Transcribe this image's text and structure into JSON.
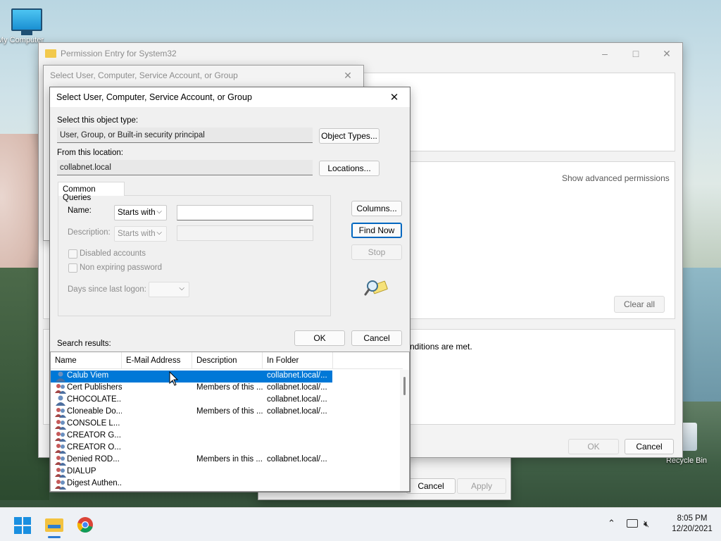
{
  "desktop": {
    "my_computer_label": "My Computer",
    "recycle_bin_label": "Recycle Bin"
  },
  "perm_window": {
    "title": "Permission Entry for System32",
    "show_advanced": "Show advanced permissions",
    "clear_all": "Clear all",
    "conditions_text": "nditions are met.",
    "ok": "OK",
    "cancel": "Cancel"
  },
  "behind_window": {
    "cancel": "Cancel",
    "apply": "Apply"
  },
  "bg_select_dialog": {
    "title": "Select User, Computer, Service Account, or Group"
  },
  "dialog": {
    "title": "Select User, Computer, Service Account, or Group",
    "object_type_label": "Select this object type:",
    "object_type_value": "User, Group, or Built-in security principal",
    "object_types_button": "Object Types...",
    "location_label": "From this location:",
    "location_value": "collabnet.local",
    "locations_button": "Locations...",
    "tab_common_queries": "Common Queries",
    "name_label": "Name:",
    "name_filter": "Starts with",
    "description_label": "Description:",
    "description_filter": "Starts with",
    "disabled_accounts": "Disabled accounts",
    "non_expiring_password": "Non expiring password",
    "days_since_last_logon": "Days since last logon:",
    "columns_button": "Columns...",
    "find_now_button": "Find Now",
    "stop_button": "Stop",
    "ok_button": "OK",
    "cancel_button": "Cancel",
    "search_results_label": "Search results:",
    "columns": [
      "Name",
      "E-Mail Address",
      "Description",
      "In Folder"
    ],
    "results": [
      {
        "name": "Calub Viem",
        "email": "",
        "description": "",
        "folder": "collabnet.local/...",
        "type": "user",
        "selected": true
      },
      {
        "name": "Cert Publishers",
        "email": "",
        "description": "Members of this ...",
        "folder": "collabnet.local/...",
        "type": "group",
        "selected": false
      },
      {
        "name": "CHOCOLATE...",
        "email": "",
        "description": "",
        "folder": "collabnet.local/...",
        "type": "user",
        "selected": false
      },
      {
        "name": "Cloneable Do...",
        "email": "",
        "description": "Members of this ...",
        "folder": "collabnet.local/...",
        "type": "group",
        "selected": false
      },
      {
        "name": "CONSOLE L...",
        "email": "",
        "description": "",
        "folder": "",
        "type": "group",
        "selected": false
      },
      {
        "name": "CREATOR G...",
        "email": "",
        "description": "",
        "folder": "",
        "type": "group",
        "selected": false
      },
      {
        "name": "CREATOR O...",
        "email": "",
        "description": "",
        "folder": "",
        "type": "group",
        "selected": false
      },
      {
        "name": "Denied ROD...",
        "email": "",
        "description": "Members in this ...",
        "folder": "collabnet.local/...",
        "type": "group",
        "selected": false
      },
      {
        "name": "DIALUP",
        "email": "",
        "description": "",
        "folder": "",
        "type": "group",
        "selected": false
      },
      {
        "name": "Digest Authen...",
        "email": "",
        "description": "",
        "folder": "",
        "type": "group",
        "selected": false
      }
    ]
  },
  "taskbar": {
    "time": "8:05 PM",
    "date": "12/20/2021"
  },
  "colors": {
    "selection": "#0078d7",
    "accent": "#0067c0"
  }
}
